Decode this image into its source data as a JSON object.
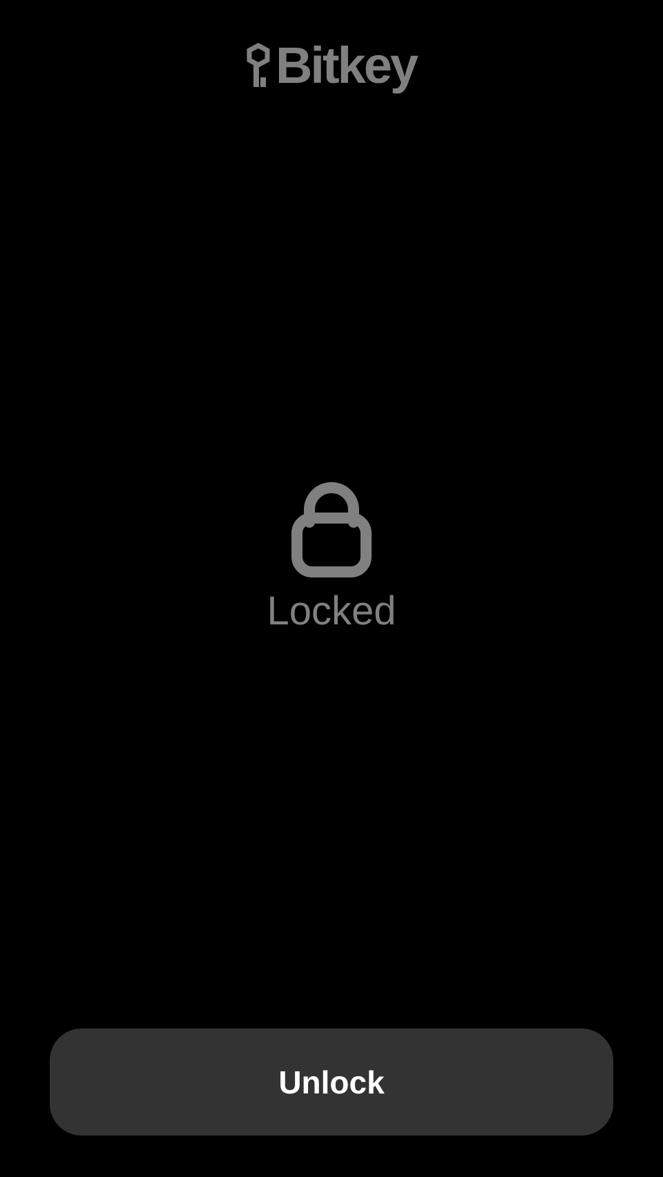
{
  "brand": {
    "name": "Bitkey",
    "icon": "bitkey-key-icon",
    "color": "#808080"
  },
  "lock_screen": {
    "icon": "lock-icon",
    "status_label": "Locked",
    "color": "#808080"
  },
  "actions": {
    "unlock_label": "Unlock",
    "button_color": "#333333"
  },
  "colors": {
    "background": "#000000",
    "text_primary": "#ffffff"
  }
}
